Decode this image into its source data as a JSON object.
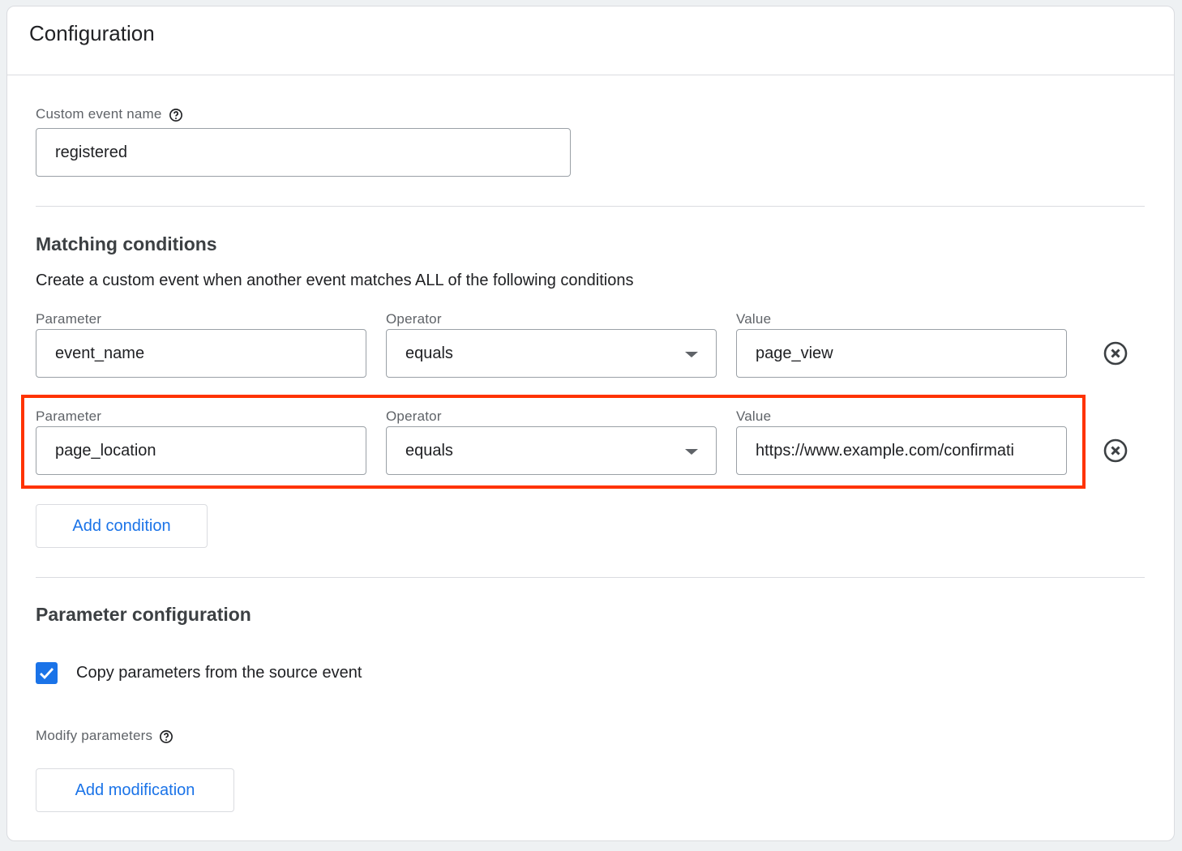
{
  "card": {
    "title": "Configuration"
  },
  "custom_event": {
    "label": "Custom event name",
    "value": "registered",
    "help_icon": "help-circle-icon"
  },
  "matching": {
    "heading": "Matching conditions",
    "description": "Create a custom event when another event matches ALL of the following conditions",
    "conditions": [
      {
        "parameter_label": "Parameter",
        "parameter": "event_name",
        "operator_label": "Operator",
        "operator": "equals",
        "value_label": "Value",
        "value": "page_view",
        "highlighted": false
      },
      {
        "parameter_label": "Parameter",
        "parameter": "page_location",
        "operator_label": "Operator",
        "operator": "equals",
        "value_label": "Value",
        "value": "https://www.example.com/confirmati",
        "highlighted": true
      }
    ],
    "add_condition": "Add condition",
    "highlight_color": "#ff3300"
  },
  "param_config": {
    "heading": "Parameter configuration",
    "copy_label": "Copy parameters from the source event",
    "copy_checked": true,
    "modify_label": "Modify parameters",
    "add_modification": "Add modification"
  },
  "colors": {
    "accent": "#1a73e8"
  }
}
